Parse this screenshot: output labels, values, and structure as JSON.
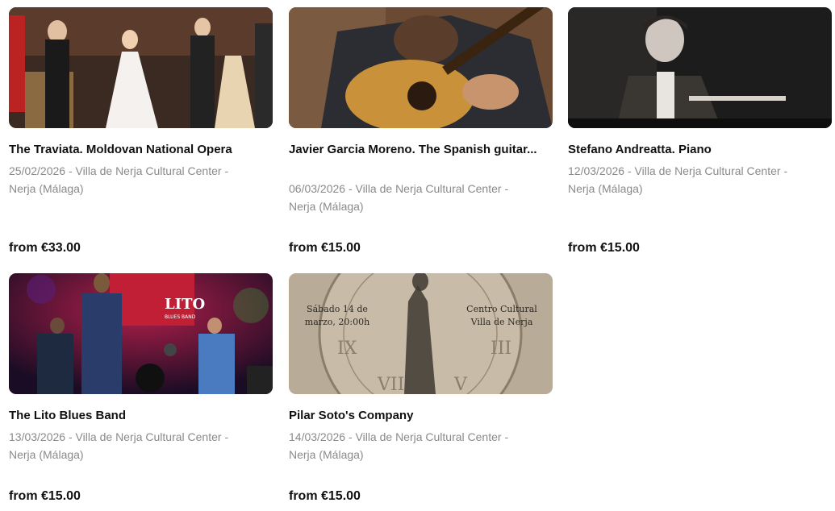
{
  "events": [
    {
      "title": "The Traviata. Moldovan National Opera",
      "date_venue": "25/02/2026 - Villa de Nerja Cultural Center - Nerja (Málaga)",
      "price": "from €33.00",
      "image": "opera-stage-photo"
    },
    {
      "title": "Javier Garcia Moreno. The Spanish guitar...",
      "date_venue": "06/03/2026 - Villa de Nerja Cultural Center - Nerja (Málaga)",
      "price": "from €15.00",
      "image": "guitarist-photo"
    },
    {
      "title": "Stefano Andreatta. Piano",
      "date_venue": "12/03/2026 - Villa de Nerja Cultural Center - Nerja (Málaga)",
      "price": "from €15.00",
      "image": "pianist-photo"
    },
    {
      "title": "The Lito Blues Band",
      "date_venue": "13/03/2026 - Villa de Nerja Cultural Center - Nerja (Málaga)",
      "price": "from €15.00",
      "image": "blues-band-photo",
      "poster_text": {
        "logo": "LITO",
        "logo_sub": "BLUES BAND"
      }
    },
    {
      "title": "Pilar Soto's Company",
      "date_venue": "14/03/2026 - Villa de Nerja Cultural Center - Nerja (Málaga)",
      "price": "from €15.00",
      "image": "clock-poster",
      "poster_text": {
        "left_line1": "Sábado 14 de",
        "left_line2": "marzo, 20:00h",
        "right_line1": "Centro Cultural",
        "right_line2": "Villa de Nerja"
      }
    }
  ]
}
